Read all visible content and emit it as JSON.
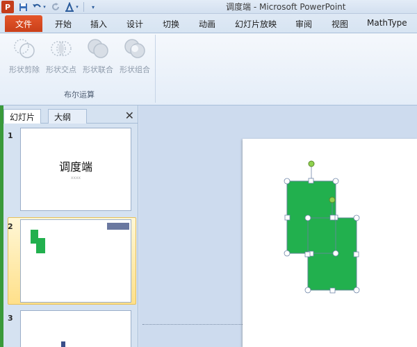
{
  "window": {
    "title": "调度端  -  Microsoft PowerPoint",
    "app_logo": "P"
  },
  "quick_access": {
    "icons": [
      "save-icon",
      "undo-icon",
      "redo-icon",
      "font-color-icon",
      "customize-icon"
    ]
  },
  "ribbon_tabs": {
    "file": "文件",
    "items": [
      "开始",
      "插入",
      "设计",
      "切换",
      "动画",
      "幻灯片放映",
      "审阅",
      "视图",
      "MathType"
    ]
  },
  "ribbon": {
    "group_label": "布尔运算",
    "buttons": [
      "形状剪除",
      "形状交点",
      "形状联合",
      "形状组合"
    ]
  },
  "slides_panel": {
    "tabs": [
      "幻灯片",
      "大纲"
    ],
    "close": "✕",
    "slides": [
      {
        "num": "1",
        "title": "调度端",
        "subtitle": "xxxx"
      },
      {
        "num": "2"
      },
      {
        "num": "3"
      }
    ]
  },
  "colors": {
    "shape_green": "#22b04e",
    "file_tab": "#d24a1f",
    "selected_thumb": "#ffe08a"
  }
}
